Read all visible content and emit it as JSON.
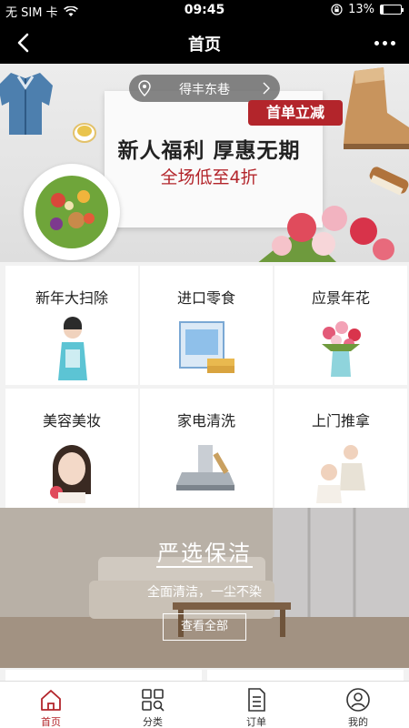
{
  "status_bar": {
    "carrier": "无 SIM 卡",
    "time": "09:45",
    "battery": "13%",
    "battery_level": 0.13
  },
  "nav": {
    "title": "首页",
    "back_icon": "back-arrow-icon",
    "more_icon": "more-dots-icon"
  },
  "banner": {
    "location": "得丰东巷",
    "tag": "首单立减",
    "headline": "新人福利  厚惠无期",
    "subline": "全场低至4折",
    "accent_color": "#b3252b"
  },
  "categories": [
    {
      "label": "新年大扫除",
      "icon": "cleaner-woman-image"
    },
    {
      "label": "进口零食",
      "icon": "snack-box-image"
    },
    {
      "label": "应景年花",
      "icon": "flower-vase-image"
    },
    {
      "label": "美容美妆",
      "icon": "beauty-woman-image"
    },
    {
      "label": "家电清洗",
      "icon": "range-hood-image"
    },
    {
      "label": "上门推拿",
      "icon": "massage-image"
    }
  ],
  "cleaning": {
    "title": "严选保洁",
    "subtitle": "全面清洁，一尘不染",
    "button": "查看全部"
  },
  "tabbar": [
    {
      "label": "首页",
      "icon": "home-icon",
      "active": true
    },
    {
      "label": "分类",
      "icon": "category-grid-icon",
      "active": false
    },
    {
      "label": "订单",
      "icon": "order-document-icon",
      "active": false
    },
    {
      "label": "我的",
      "icon": "user-profile-icon",
      "active": false
    }
  ]
}
